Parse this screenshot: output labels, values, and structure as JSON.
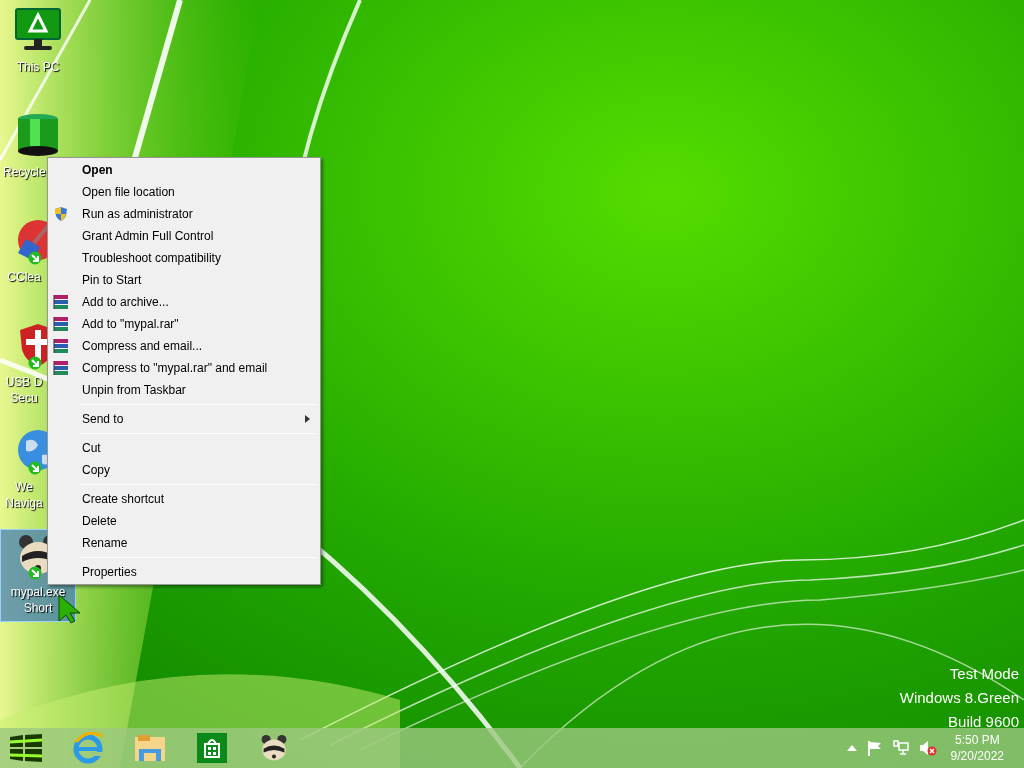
{
  "desktop_icons": [
    {
      "kind": "monitor",
      "label_lines": [
        "This PC"
      ],
      "shortcut": false,
      "selected": false
    },
    {
      "kind": "bin",
      "label_lines": [
        "Recycle"
      ],
      "shortcut": false,
      "selected": false
    },
    {
      "kind": "broom",
      "label_lines": [
        "CClea"
      ],
      "shortcut": true,
      "selected": false
    },
    {
      "kind": "shield",
      "label_lines": [
        "USB D",
        "Secu"
      ],
      "shortcut": true,
      "selected": false
    },
    {
      "kind": "globe",
      "label_lines": [
        "We",
        "Naviga"
      ],
      "shortcut": true,
      "selected": false
    },
    {
      "kind": "raccoon",
      "label_lines": [
        "mypal.exe",
        "Short"
      ],
      "shortcut": true,
      "selected": true
    }
  ],
  "context_menu": {
    "groups": [
      [
        {
          "kind": "default",
          "label": "Open"
        },
        {
          "kind": "plain",
          "label": "Open file location"
        },
        {
          "kind": "shield",
          "label": "Run as administrator"
        },
        {
          "kind": "plain",
          "label": "Grant Admin Full Control"
        },
        {
          "kind": "plain",
          "label": "Troubleshoot compatibility"
        },
        {
          "kind": "plain",
          "label": "Pin to Start"
        },
        {
          "kind": "archive",
          "label": "Add to archive..."
        },
        {
          "kind": "archive",
          "label": "Add to \"mypal.rar\""
        },
        {
          "kind": "archive",
          "label": "Compress and email..."
        },
        {
          "kind": "archive",
          "label": "Compress to \"mypal.rar\" and email"
        },
        {
          "kind": "plain",
          "label": "Unpin from Taskbar"
        }
      ],
      [
        {
          "kind": "submenu",
          "label": "Send to"
        }
      ],
      [
        {
          "kind": "plain",
          "label": "Cut"
        },
        {
          "kind": "plain",
          "label": "Copy"
        }
      ],
      [
        {
          "kind": "plain",
          "label": "Create shortcut"
        },
        {
          "kind": "plain",
          "label": "Delete"
        },
        {
          "kind": "plain",
          "label": "Rename"
        }
      ],
      [
        {
          "kind": "plain",
          "label": "Properties"
        }
      ]
    ]
  },
  "desktop_text": [
    "Test Mode",
    "Windows 8.Green",
    "Build 9600"
  ],
  "taskbar": {
    "apps": [
      {
        "kind": "start"
      },
      {
        "kind": "browser"
      },
      {
        "kind": "folder"
      },
      {
        "kind": "store"
      },
      {
        "kind": "raccoon"
      }
    ],
    "tray": [
      {
        "kind": "arrow"
      },
      {
        "kind": "flag"
      },
      {
        "kind": "network"
      },
      {
        "kind": "speaker-muted"
      }
    ],
    "clock": {
      "time": "5:50 PM",
      "date": "9/20/2022"
    }
  }
}
